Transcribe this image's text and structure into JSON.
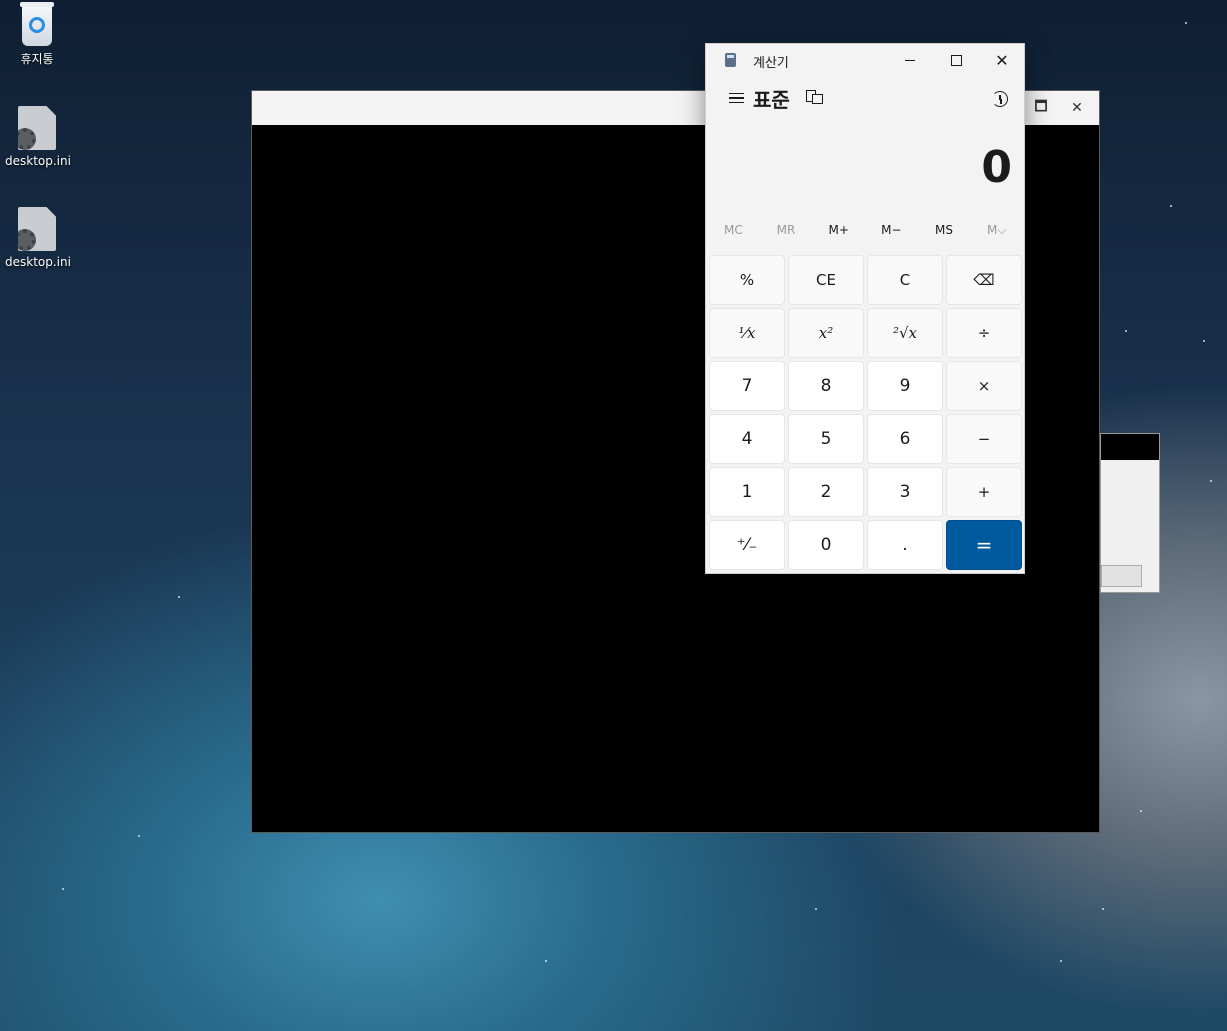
{
  "desktop": {
    "icons": [
      {
        "label": "휴지통",
        "icon": "recycle-bin-icon"
      },
      {
        "label": "desktop.ini",
        "icon": "settings-file-icon"
      },
      {
        "label": "desktop.ini",
        "icon": "settings-file-icon"
      }
    ]
  },
  "background_window": {
    "maximize_glyph": "🗖",
    "close_glyph": "✕"
  },
  "calculator": {
    "title": "계산기",
    "mode": "표준",
    "display": "0",
    "memory": [
      "MC",
      "MR",
      "M+",
      "M−",
      "MS",
      "M⌵"
    ],
    "keys": [
      "%",
      "CE",
      "C",
      "⌫",
      "¹⁄𝑥",
      "𝑥²",
      "²√𝑥",
      "÷",
      "7",
      "8",
      "9",
      "×",
      "4",
      "5",
      "6",
      "−",
      "1",
      "2",
      "3",
      "+",
      "⁺⁄₋",
      "0",
      ".",
      "="
    ],
    "accent_color": "#005a9e"
  }
}
